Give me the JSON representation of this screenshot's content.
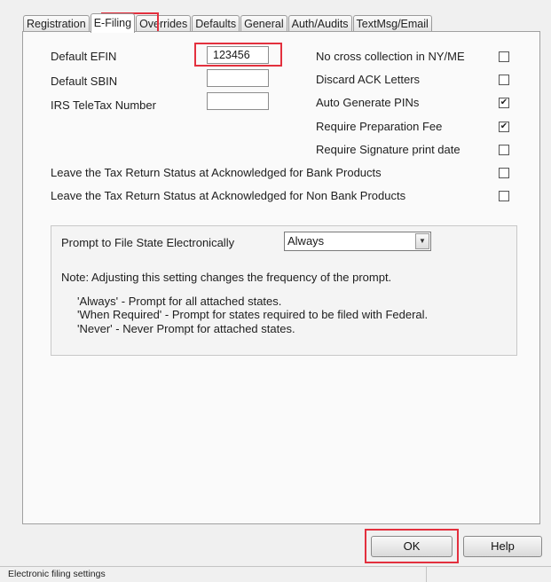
{
  "tabs": [
    {
      "label": "Registration",
      "active": false
    },
    {
      "label": "E-Filing",
      "active": true
    },
    {
      "label": "Overrides",
      "active": false
    },
    {
      "label": "Defaults",
      "active": false
    },
    {
      "label": "General",
      "active": false
    },
    {
      "label": "Auth/Audits",
      "active": false
    },
    {
      "label": "TextMsg/Email",
      "active": false
    }
  ],
  "fields": {
    "efin_label": "Default EFIN",
    "efin_value": "123456",
    "sbin_label": "Default SBIN",
    "sbin_value": "",
    "teletax_label": "IRS TeleTax Number",
    "teletax_value": ""
  },
  "options": [
    {
      "label": "No cross collection in NY/ME",
      "checked": false
    },
    {
      "label": "Discard ACK Letters",
      "checked": false
    },
    {
      "label": "Auto Generate PINs",
      "checked": true
    },
    {
      "label": "Require Preparation Fee",
      "checked": true
    },
    {
      "label": "Require Signature print date",
      "checked": false
    }
  ],
  "wide_options": [
    {
      "label": "Leave the Tax Return Status at Acknowledged for Bank Products",
      "checked": false
    },
    {
      "label": "Leave the Tax Return Status at Acknowledged for Non Bank Products",
      "checked": false
    }
  ],
  "prompt": {
    "label": "Prompt to File State Electronically",
    "selected": "Always",
    "note": "Note: Adjusting this setting changes the frequency of the prompt.",
    "lines": [
      "'Always' - Prompt for all attached states.",
      "'When Required' - Prompt for states required to be filed with Federal.",
      "'Never' - Never Prompt for attached states."
    ]
  },
  "buttons": {
    "ok": "OK",
    "help": "Help"
  },
  "status_text": "Electronic filing settings",
  "icons": {
    "check": "check-mark-icon",
    "dropdown": "chevron-down-icon"
  },
  "colors": {
    "highlight": "#e3303e"
  }
}
